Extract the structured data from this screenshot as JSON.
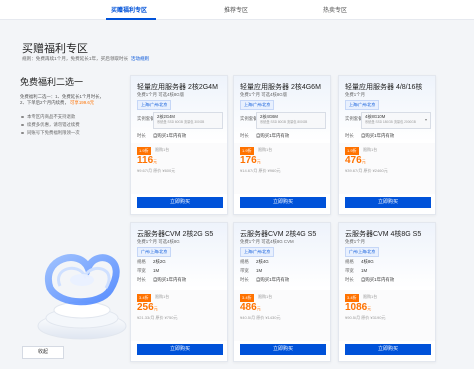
{
  "tabs": [
    {
      "label": "买赠福利专区",
      "active": true
    },
    {
      "label": "推荐专区",
      "active": false
    },
    {
      "label": "热卖专区",
      "active": false
    }
  ],
  "page_title": "买赠福利专区",
  "rule": {
    "prefix": "规则：",
    "text": "免费再续1个月，免费延长1年，买后领取时长",
    "link": "活动规则"
  },
  "left": {
    "title": "免费福利二选一",
    "desc_1": "免费福利二选一：1、免费延长1个月时长，",
    "desc_2": "2、下单后2个月内续费，",
    "desc_hl": "可享199.6元",
    "notes": [
      "本专区内商品不支持退款",
      "续费多优惠，请勿错过续费",
      "同账号下免费福利限领一次"
    ]
  },
  "collapse_label": "收起",
  "cards": [
    {
      "title": "轻量应用服务器 2核2G4M",
      "sub": "免费1个月 可选4核8G版",
      "region": "上海/广州/北京",
      "rows": [
        {
          "label": "配置",
          "value": "2核2G4M"
        },
        {
          "label": "时长",
          "value": "自购买1年内有效"
        }
      ],
      "box_label": "实例套餐",
      "box_main": "2核2G4M",
      "box_tiny": "系统盘 SSD 60GB 流量包 300GB",
      "discount": "1.9折",
      "discount_note": "限购1台",
      "price": "116",
      "price_unit": "元",
      "orig": "¥9.67/月 原价 ¥600元"
    },
    {
      "title": "轻量应用服务器 2核4G6M",
      "sub": "免费1个月 可选4核8G版",
      "region": "上海/广州/北京",
      "rows": [
        {
          "label": "配置",
          "value": "2核4G6M"
        },
        {
          "label": "时长",
          "value": "自购买1年内有效"
        }
      ],
      "box_label": "实例套餐",
      "box_main": "2核4G6M",
      "box_tiny": "系统盘 SSD 80GB 流量包 800GB",
      "discount": "1.9折",
      "discount_note": "限购1台",
      "price": "176",
      "price_unit": "元",
      "orig": "¥14.67/月 原价 ¥960元"
    },
    {
      "title": "轻量应用服务器 4/8/16核",
      "sub": "免费1个月",
      "region": "上海/广州/北京",
      "rows": [
        {
          "label": "时长",
          "value": "自购买1年内有效"
        }
      ],
      "box_label": "实例套餐",
      "box_main": "4核8G10M",
      "box_tiny": "系统盘 SSD 180GB 流量包 2000GB",
      "discount": "1.9折",
      "discount_note": "限购1台",
      "price": "476",
      "price_unit": "元",
      "orig": "¥39.67/月 原价 ¥2460元"
    },
    {
      "title": "云服务器CVM 2核2G S5",
      "sub": "免费1个月 可选4核8G",
      "region": "广州/上海/北京",
      "rows": [
        {
          "label": "规格",
          "value": "2核2G"
        },
        {
          "label": "带宽",
          "value": "1M"
        },
        {
          "label": "时长",
          "value": "自购买1年内有效"
        }
      ],
      "discount": "3.4折",
      "discount_note": "限购1台",
      "price": "256",
      "price_unit": "元",
      "orig": "¥21.33/月 原价 ¥750元"
    },
    {
      "title": "云服务器CVM 2核4G S5",
      "sub": "免费1个月 可选4核8G CVM",
      "region": "上海/广州/北京",
      "rows": [
        {
          "label": "规格",
          "value": "2核4G"
        },
        {
          "label": "带宽",
          "value": "1M"
        },
        {
          "label": "时长",
          "value": "自购买1年内有效"
        }
      ],
      "discount": "3.4折",
      "discount_note": "限购1台",
      "price": "486",
      "price_unit": "元",
      "orig": "¥40.5/月 原价 ¥1430元"
    },
    {
      "title": "云服务器CVM 4核8G S5",
      "sub": "免费1个月",
      "region": "广州/上海/北京",
      "rows": [
        {
          "label": "规格",
          "value": "4核8G"
        },
        {
          "label": "带宽",
          "value": "1M"
        },
        {
          "label": "时长",
          "value": "自购买1年内有效"
        }
      ],
      "discount": "3.4折",
      "discount_note": "限购1台",
      "price": "1086",
      "price_unit": "元",
      "orig": "¥90.5/月 原价 ¥3190元"
    }
  ],
  "buy_label": "立即购买"
}
